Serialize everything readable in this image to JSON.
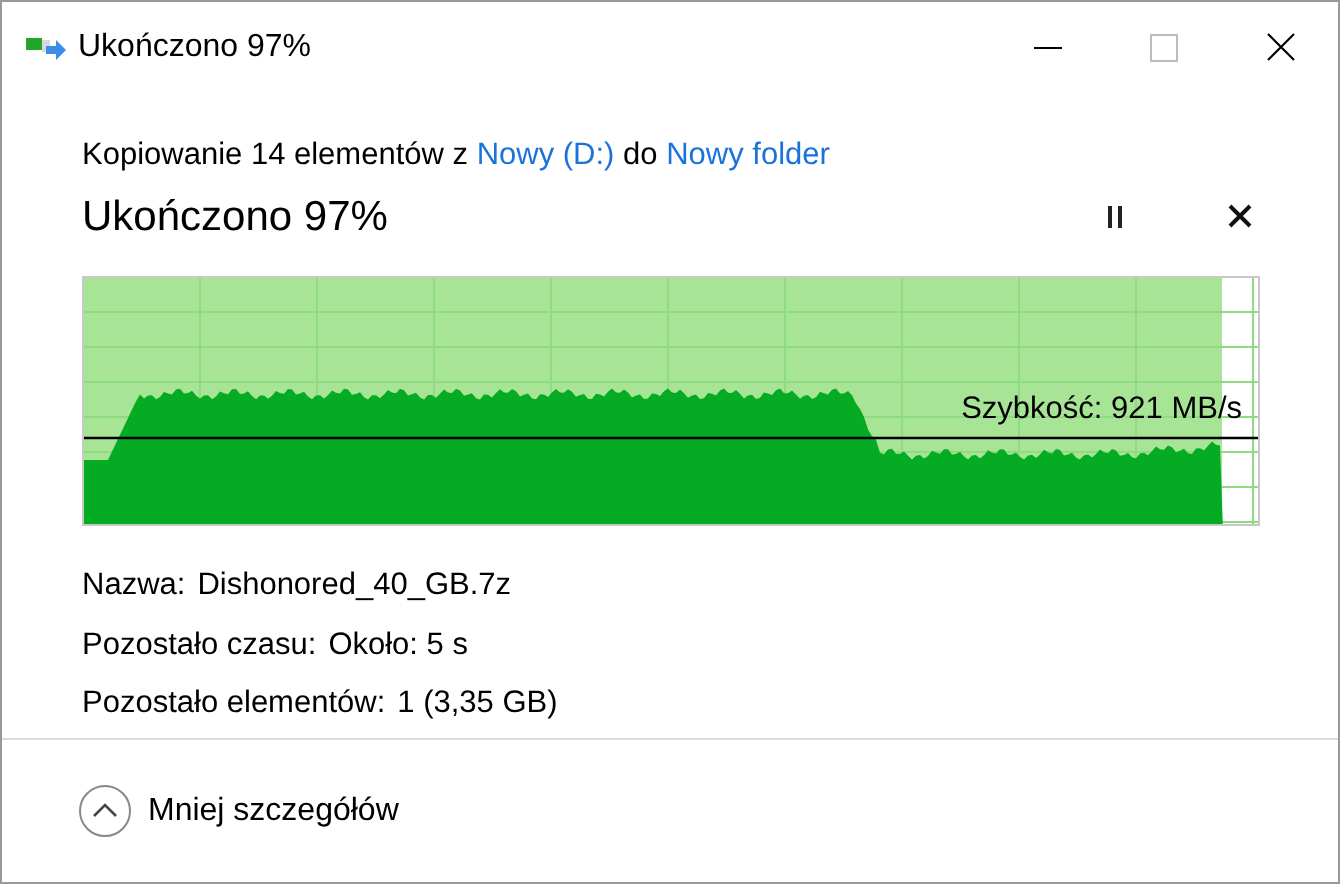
{
  "window": {
    "title": "Ukończono 97%"
  },
  "summary": {
    "prefix": "Kopiowanie 14 elementów z",
    "source": "Nowy (D:)",
    "joiner": "do",
    "destination": "Nowy folder"
  },
  "status": {
    "heading": "Ukończono 97%"
  },
  "progress": {
    "level": 0.97,
    "speed": "Szybkość: 921 MB/s"
  },
  "details": [
    {
      "label": "Nazwa:",
      "value": "Dishonored_40_GB.7z"
    },
    {
      "label": "Pozostało czasu:",
      "value": "Około: 5 s"
    },
    {
      "label": "Pozostało elementów:",
      "value": "1 (3,35 GB)"
    }
  ],
  "footer": {
    "toggle": "Mniej szczegółów"
  }
}
